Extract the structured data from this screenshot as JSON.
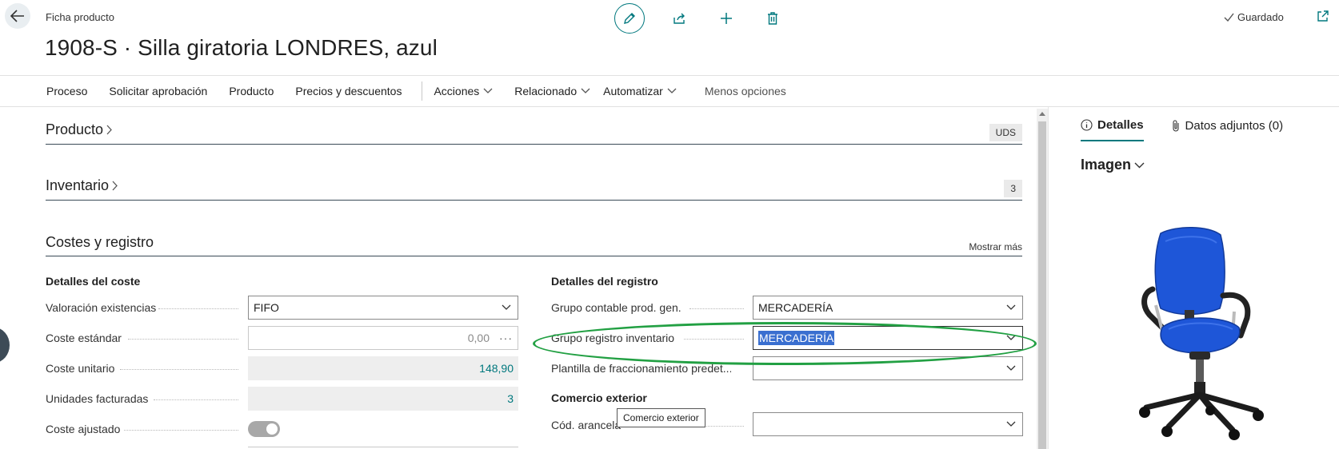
{
  "header": {
    "breadcrumb": "Ficha producto",
    "title": "1908-S · Silla giratoria LONDRES, azul",
    "status": "Guardado"
  },
  "action_bar": {
    "items": [
      "Proceso",
      "Solicitar aprobación",
      "Producto",
      "Precios y descuentos"
    ],
    "dropdowns": [
      "Acciones",
      "Relacionado",
      "Automatizar"
    ],
    "less_options": "Menos opciones"
  },
  "sections": {
    "producto": {
      "title": "Producto",
      "badge": "UDS"
    },
    "inventario": {
      "title": "Inventario",
      "badge": "3"
    },
    "costes": {
      "title": "Costes y registro",
      "show_more": "Mostrar más"
    }
  },
  "cost_details": {
    "title": "Detalles del coste",
    "valuation_label": "Valoración existencias",
    "valuation_value": "FIFO",
    "standard_cost_label": "Coste estándar",
    "standard_cost_value": "0,00",
    "standard_cost_more": "···",
    "unit_cost_label": "Coste unitario",
    "unit_cost_value": "148,90",
    "invoiced_units_label": "Unidades facturadas",
    "invoiced_units_value": "3",
    "adjusted_cost_label": "Coste ajustado",
    "adjusted_cost_on": true
  },
  "posting_details": {
    "title": "Detalles del registro",
    "gen_prod_group_label": "Grupo contable prod. gen.",
    "gen_prod_group_value": "MERCADERÍA",
    "inventory_group_label": "Grupo registro inventario",
    "inventory_group_value": "MERCADERÍA",
    "template_label": "Plantilla de fraccionamiento predet...",
    "template_value": ""
  },
  "foreign_trade": {
    "title": "Comercio exterior",
    "tariff_label": "Cód. arancela",
    "tariff_value": "",
    "tooltip": "Comercio exterior"
  },
  "factbox": {
    "tab_details": "Detalles",
    "tab_attachments": "Datos adjuntos (0)",
    "section": "Imagen",
    "image_subject": "blue office swivel chair"
  },
  "colors": {
    "accent": "#00787e",
    "highlight_ring": "#22a043",
    "selection": "#3a6fd0",
    "chair_blue": "#1e56d8"
  }
}
